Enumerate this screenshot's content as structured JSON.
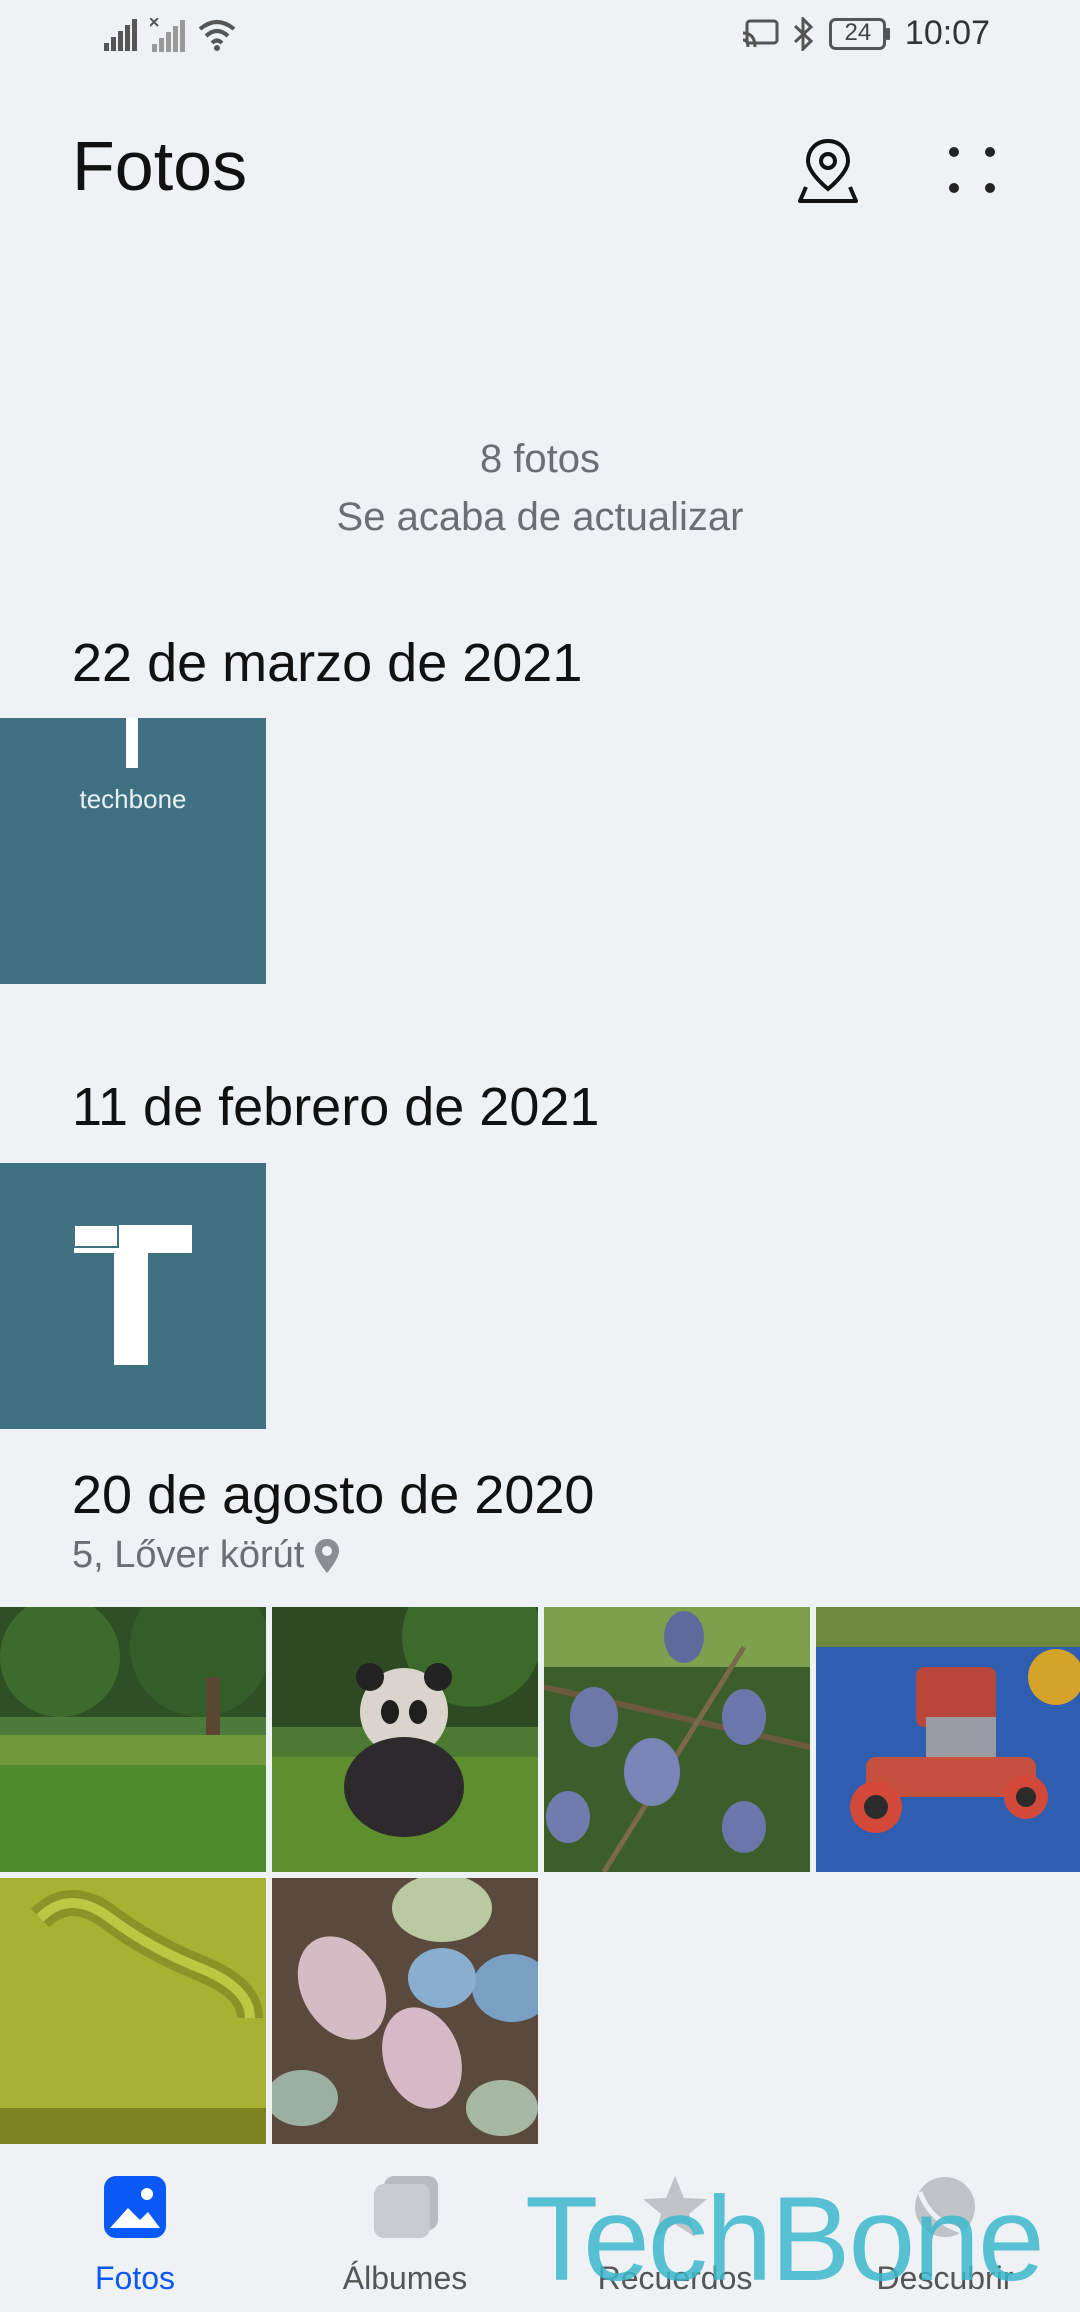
{
  "status_bar": {
    "time": "10:07",
    "battery": "24"
  },
  "header": {
    "title": "Fotos",
    "map_icon": "location-pin-icon",
    "more_icon": "more-dots-icon"
  },
  "info": {
    "count": "8 fotos",
    "status": "Se acaba de actualizar"
  },
  "sections": [
    {
      "date": "22 de marzo de 2021",
      "thumb_text": "techbone"
    },
    {
      "date": "11 de febrero de 2021"
    },
    {
      "date": "20 de agosto de 2020",
      "location": "5, Lőver körút"
    }
  ],
  "bottom_nav": [
    {
      "label": "Fotos",
      "active": true
    },
    {
      "label": "Álbumes"
    },
    {
      "label": "Recuerdos"
    },
    {
      "label": "Descubrir"
    }
  ],
  "watermark": "TechBone",
  "colors": {
    "accent": "#0a59f7",
    "tile_teal": "#3f7182"
  }
}
